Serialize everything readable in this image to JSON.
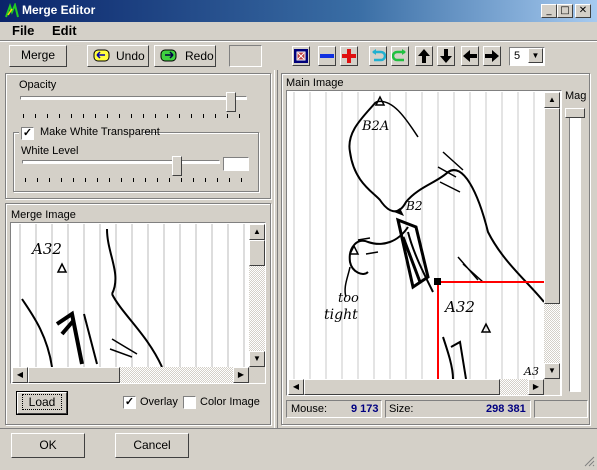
{
  "window": {
    "title": "Merge Editor"
  },
  "menu": {
    "file": "File",
    "edit": "Edit"
  },
  "toolbar": {
    "merge": "Merge",
    "undo": "Undo",
    "redo": "Redo",
    "spin_value": "5"
  },
  "opacity": {
    "label": "Opacity",
    "level": 0.95
  },
  "white": {
    "checkbox_label": "Make White Transparent",
    "checked": true,
    "level_label": "White Level",
    "level": 0.8
  },
  "merge_image": {
    "label": "Merge Image",
    "text_a32": "A32"
  },
  "load": {
    "label": "Load"
  },
  "options": {
    "overlay_label": "Overlay",
    "overlay_checked": true,
    "color_label": "Color Image",
    "color_checked": false
  },
  "main_image": {
    "label": "Main Image",
    "mag_label": "Mag",
    "text_b2a": "B2A",
    "text_b2": "B2",
    "text_too": "too",
    "text_tight": "tight",
    "text_a32": "A32",
    "text_a3": "A3"
  },
  "status": {
    "mouse_label": "Mouse:",
    "mouse_value": "9 173",
    "size_label": "Size:",
    "size_value": "298 381"
  },
  "footer": {
    "ok": "OK",
    "cancel": "Cancel"
  },
  "colors": {
    "title_start": "#0a246a",
    "title_end": "#a6caf0",
    "crosshair": "#ff0000",
    "status_value": "#000080"
  }
}
